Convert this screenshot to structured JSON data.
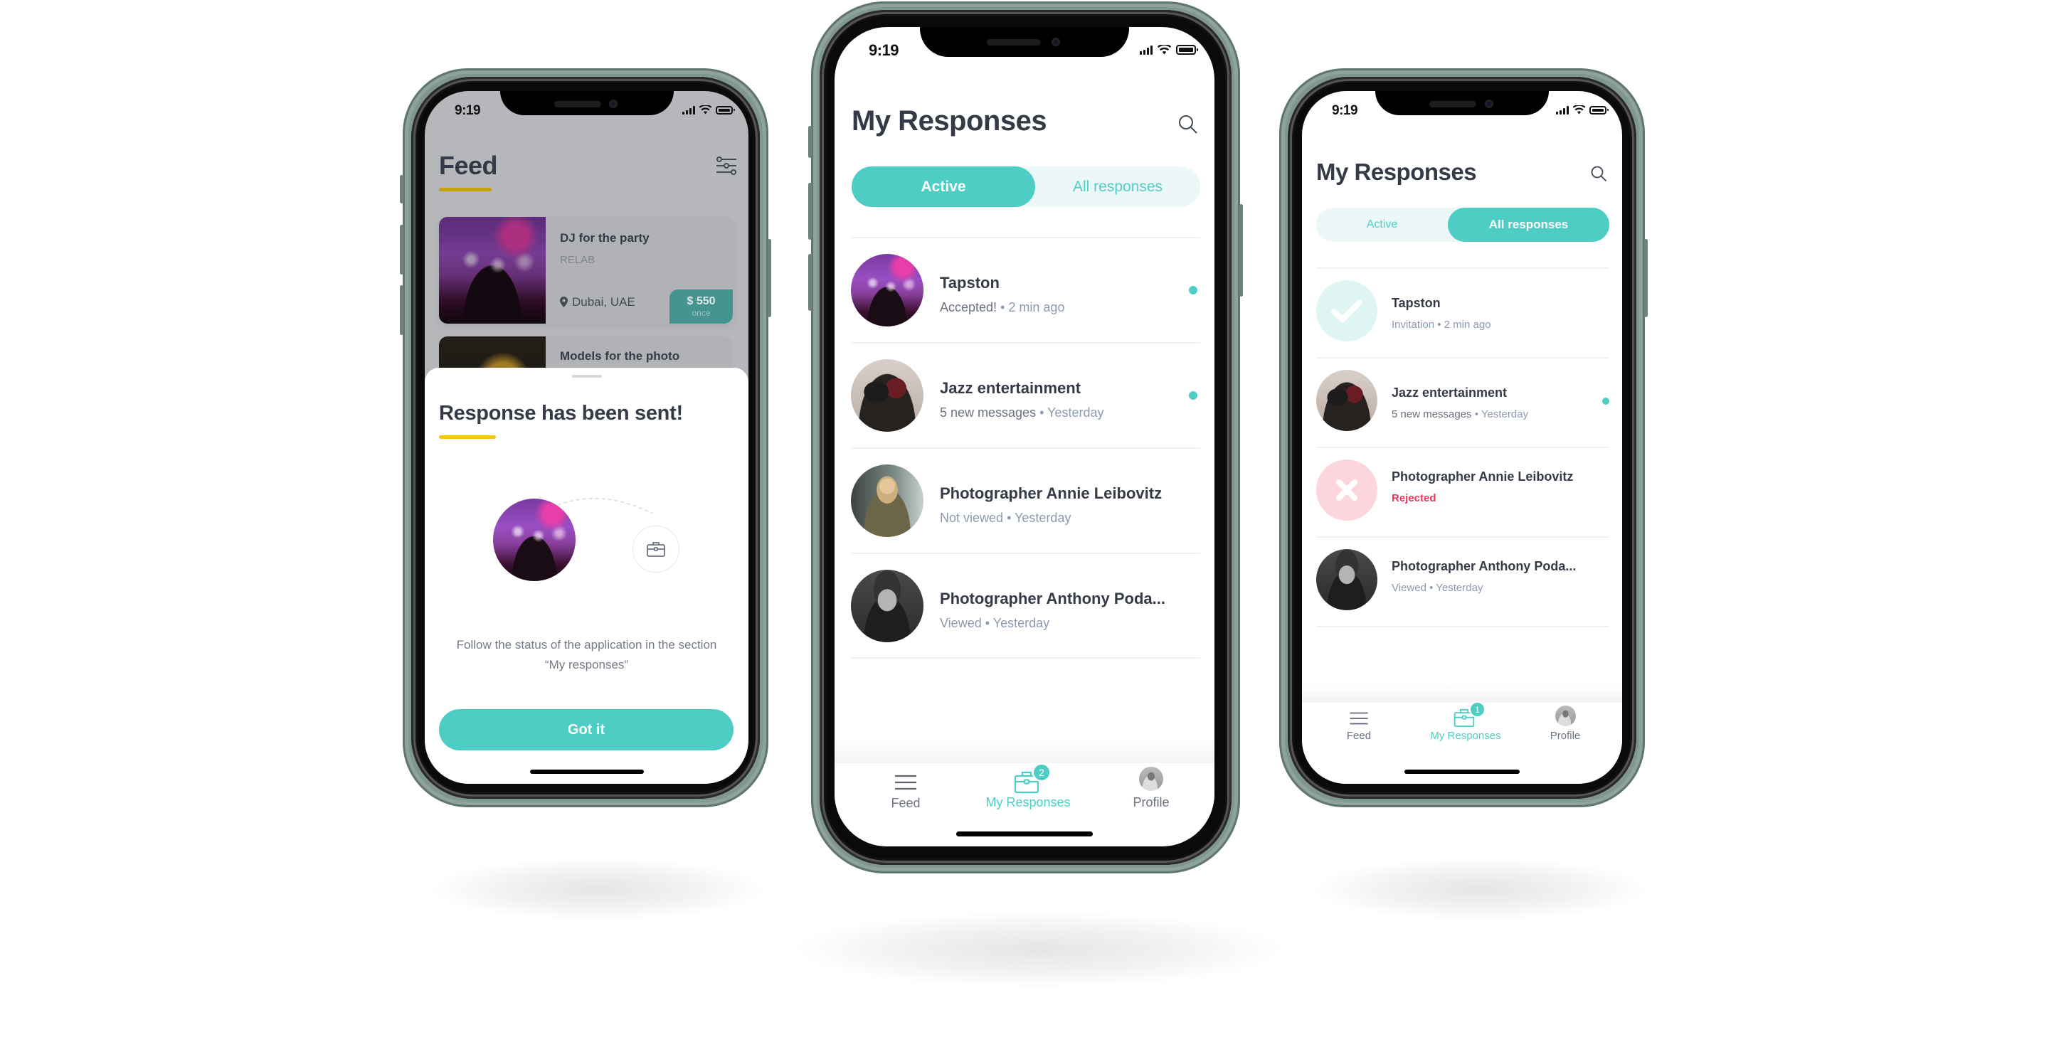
{
  "status_bar": {
    "time": "9:19"
  },
  "colors": {
    "accent": "#4ecdc4",
    "title": "#343a46",
    "underline": "#f5c518",
    "rejected": "#f0365e",
    "frame": "#7f9790"
  },
  "left_phone": {
    "feed": {
      "title": "Feed",
      "filter_icon": "filter-sliders-icon",
      "cards": [
        {
          "title": "DJ for the party",
          "company": "RELAB",
          "location": "Dubai, UAE",
          "price": "$ 550",
          "price_period": "once"
        },
        {
          "title": "Models for the photo"
        }
      ]
    },
    "sheet": {
      "title": "Response has been sent!",
      "message_line1": "Follow the status of the application in the section",
      "message_line2": "“My responses”",
      "button": "Got it",
      "icon": "briefcase-icon"
    }
  },
  "center_phone": {
    "title": "My Responses",
    "search_icon": "search-icon",
    "segments": [
      {
        "label": "Active",
        "selected": true
      },
      {
        "label": "All responses",
        "selected": false
      }
    ],
    "items": [
      {
        "name": "Tapston",
        "status": "Accepted!",
        "sep": "•",
        "time": "2 min ago",
        "unread": true
      },
      {
        "name": "Jazz entertainment",
        "status": "5 new messages",
        "sep": "•",
        "time": "Yesterday",
        "unread": true
      },
      {
        "name": "Photographer Annie Leibovitz",
        "status": "Not viewed",
        "sep": "•",
        "time": "Yesterday",
        "unread": false
      },
      {
        "name": "Photographer Anthony Poda...",
        "status": "Viewed",
        "sep": "•",
        "time": "Yesterday",
        "unread": false
      }
    ],
    "tabbar": {
      "tabs": [
        {
          "label": "Feed",
          "icon": "menu-icon"
        },
        {
          "label": "My Responses",
          "icon": "briefcase-icon",
          "badge": "2",
          "active": true
        },
        {
          "label": "Profile",
          "icon": "avatar"
        }
      ]
    }
  },
  "right_phone": {
    "title": "My Responses",
    "search_icon": "search-icon",
    "segments": [
      {
        "label": "Active",
        "selected": false
      },
      {
        "label": "All responses",
        "selected": true
      }
    ],
    "items": [
      {
        "name": "Tapston",
        "status": "Invitation",
        "sep": "•",
        "time": "2 min ago",
        "state": "accepted"
      },
      {
        "name": "Jazz entertainment",
        "status": "5 new messages",
        "sep": "•",
        "time": "Yesterday",
        "unread": true
      },
      {
        "name": "Photographer Annie Leibovitz",
        "status": "Rejected",
        "state": "rejected"
      },
      {
        "name": "Photographer Anthony Poda...",
        "status": "Viewed",
        "sep": "•",
        "time": "Yesterday"
      }
    ],
    "tabbar": {
      "tabs": [
        {
          "label": "Feed",
          "icon": "menu-icon"
        },
        {
          "label": "My Responses",
          "icon": "briefcase-icon",
          "badge": "1",
          "active": true
        },
        {
          "label": "Profile",
          "icon": "avatar"
        }
      ]
    }
  }
}
